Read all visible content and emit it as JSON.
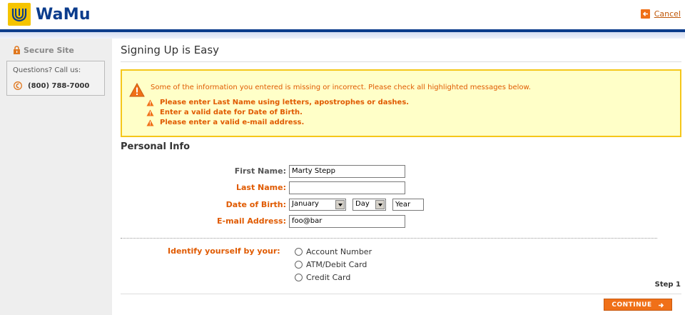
{
  "header": {
    "brand": "WaMu",
    "cancel_label": "Cancel"
  },
  "sidebar": {
    "secure_label": "Secure Site",
    "questions_label": "Questions? Call us:",
    "phone": "(800) 788-7000"
  },
  "main": {
    "title": "Signing Up is Easy",
    "alert": {
      "message": "Some of the information you entered is missing or incorrect. Please check all highlighted messages below.",
      "errors": [
        "Please enter Last Name using letters, apostrophes or dashes.",
        "Enter a valid date for Date of Birth.",
        "Please enter a valid e-mail address."
      ]
    },
    "section_title": "Personal Info",
    "form": {
      "first_name_label": "First Name:",
      "first_name_value": "Marty Stepp",
      "last_name_label": "Last Name:",
      "last_name_value": "",
      "dob_label": "Date of Birth:",
      "dob_month": "January",
      "dob_day": "Day",
      "dob_year": "Year",
      "email_label": "E-mail Address:",
      "email_value": "foo@bar"
    },
    "identify": {
      "label": "Identify yourself by your:",
      "options": [
        "Account Number",
        "ATM/Debit Card",
        "Credit Card"
      ]
    },
    "step_label": "Step 1",
    "continue_label": "CONTINUE"
  },
  "colors": {
    "brand_blue": "#0b3c8c",
    "brand_yellow": "#f5c400",
    "error_orange": "#e05a00",
    "alert_background": "#ffffc8",
    "alert_border": "#f5c71a",
    "button_orange": "#f07018"
  },
  "icons": {
    "logo": "wamu-logo-icon",
    "cancel": "cancel-arrow-icon",
    "secure": "lock-icon",
    "phone": "phone-icon",
    "warning": "warning-icon",
    "continue": "arrow-right-icon"
  }
}
